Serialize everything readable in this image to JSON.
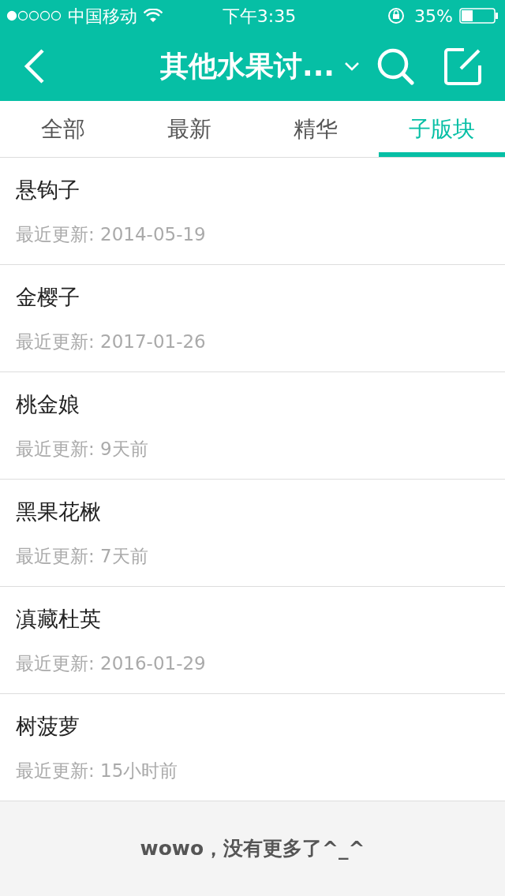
{
  "status_bar": {
    "carrier": "中国移动",
    "time": "下午3:35",
    "battery": "35%"
  },
  "nav_bar": {
    "title": "其他水果讨..."
  },
  "tabs": [
    {
      "label": "全部",
      "selected": false
    },
    {
      "label": "最新",
      "selected": false
    },
    {
      "label": "精华",
      "selected": false
    },
    {
      "label": "子版块",
      "selected": true
    }
  ],
  "list": [
    {
      "name": "悬钩子",
      "updated": "最近更新: 2014-05-19"
    },
    {
      "name": "金樱子",
      "updated": "最近更新: 2017-01-26"
    },
    {
      "name": "桃金娘",
      "updated": "最近更新: 9天前"
    },
    {
      "name": "黑果花楸",
      "updated": "最近更新: 7天前"
    },
    {
      "name": "滇藏杜英",
      "updated": "最近更新: 2016-01-29"
    },
    {
      "name": "树菠萝",
      "updated": "最近更新: 15小时前"
    }
  ],
  "footer": "wowo，没有更多了^_^"
}
